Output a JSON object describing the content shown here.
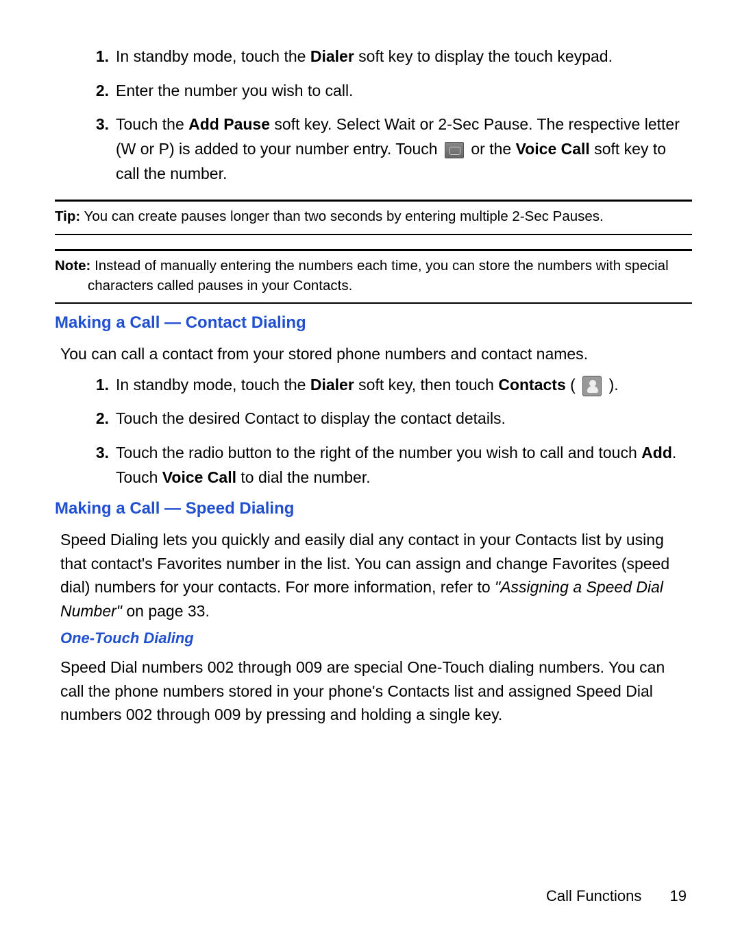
{
  "list1": {
    "items": [
      {
        "num": "1.",
        "pre": "In standby mode, touch the ",
        "bold1": "Dialer",
        "post1": " soft key to display the touch keypad."
      },
      {
        "num": "2.",
        "text": "Enter the number you wish to call."
      },
      {
        "num": "3.",
        "pre": "Touch the ",
        "bold1": "Add Pause",
        "mid1": " soft key. Select Wait or 2-Sec Pause. The respective letter (W or P) is added to your number entry. Touch ",
        "mid2": " or the ",
        "bold2": "Voice Call",
        "post": " soft key to call the number."
      }
    ]
  },
  "tip": {
    "label": "Tip:",
    "text": " You can create pauses longer than two seconds by entering multiple 2-Sec Pauses."
  },
  "note": {
    "label": "Note:",
    "text": " Instead of manually entering the numbers each time, you can store the numbers with special characters called pauses in your Contacts."
  },
  "section_contact": {
    "heading": "Making a Call — Contact Dialing",
    "intro": "You can call a contact from your stored phone numbers and contact names.",
    "items": [
      {
        "num": "1.",
        "pre": "In standby mode, touch the ",
        "bold1": "Dialer",
        "mid1": " soft key, then touch ",
        "bold2": "Contacts",
        "post": " ( ",
        "post2": " )."
      },
      {
        "num": "2.",
        "text": "Touch the desired Contact to display the contact details."
      },
      {
        "num": "3.",
        "pre": "Touch the radio button to the right of the number you wish to call and touch ",
        "bold1": "Add",
        "mid1": ". Touch ",
        "bold2": "Voice Call",
        "post": " to dial the number."
      }
    ]
  },
  "section_speed": {
    "heading": "Making a Call — Speed Dialing",
    "para_pre": "Speed Dialing lets you quickly and easily dial any contact in your Contacts list by using that contact's Favorites number in the list. You can assign and change Favorites (speed dial) numbers for your contacts. For more information, refer to ",
    "para_italic": "\"Assigning a Speed Dial Number\"",
    "para_post": "  on page 33."
  },
  "section_onetouch": {
    "heading": "One-Touch Dialing",
    "para": "Speed Dial numbers 002 through 009 are special One-Touch dialing numbers. You can call the phone numbers stored in your phone's Contacts list and assigned Speed Dial numbers 002 through 009 by pressing and holding a single key."
  },
  "footer": {
    "section": "Call Functions",
    "page": "19"
  }
}
